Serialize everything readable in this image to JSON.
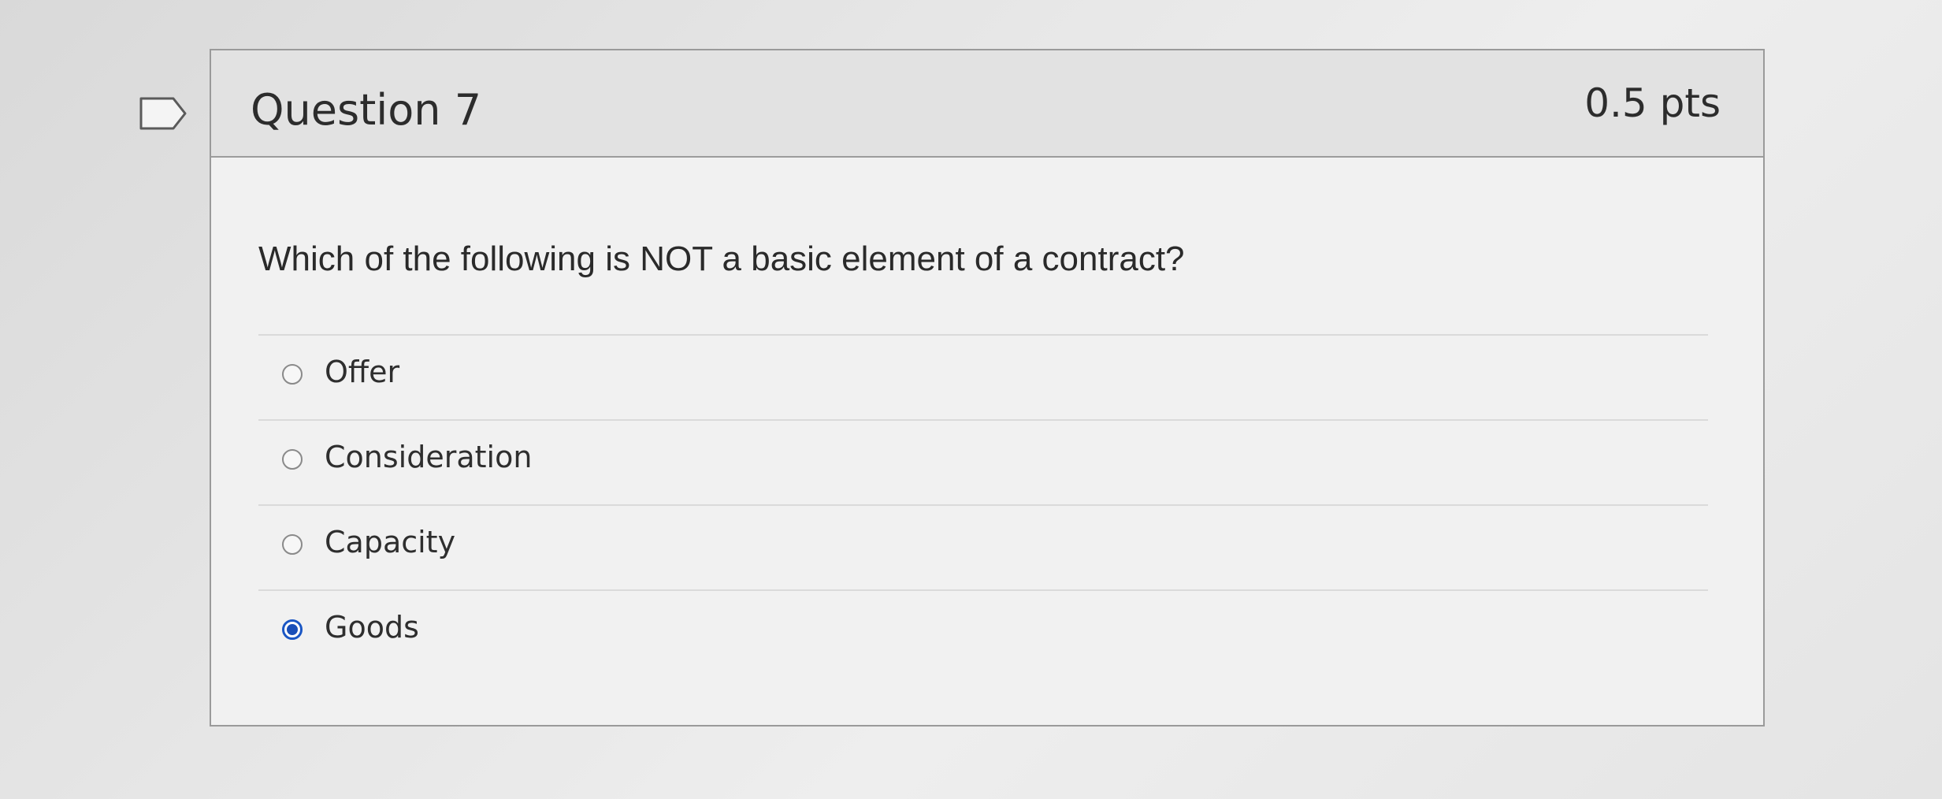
{
  "question": {
    "title": "Question 7",
    "points": "0.5 pts",
    "text": "Which of the following is NOT a basic element of a contract?",
    "answers": [
      {
        "label": "Offer",
        "selected": false
      },
      {
        "label": "Consideration",
        "selected": false
      },
      {
        "label": "Capacity",
        "selected": false
      },
      {
        "label": "Goods",
        "selected": true
      }
    ]
  },
  "icons": {
    "bookmark": "bookmark-flag-icon",
    "radio_unselected": "radio-empty-icon",
    "radio_selected": "radio-filled-icon"
  },
  "colors": {
    "selected_radio": "#1a56c4",
    "header_bg": "#e2e2e2",
    "card_border": "#9a9a9a"
  }
}
